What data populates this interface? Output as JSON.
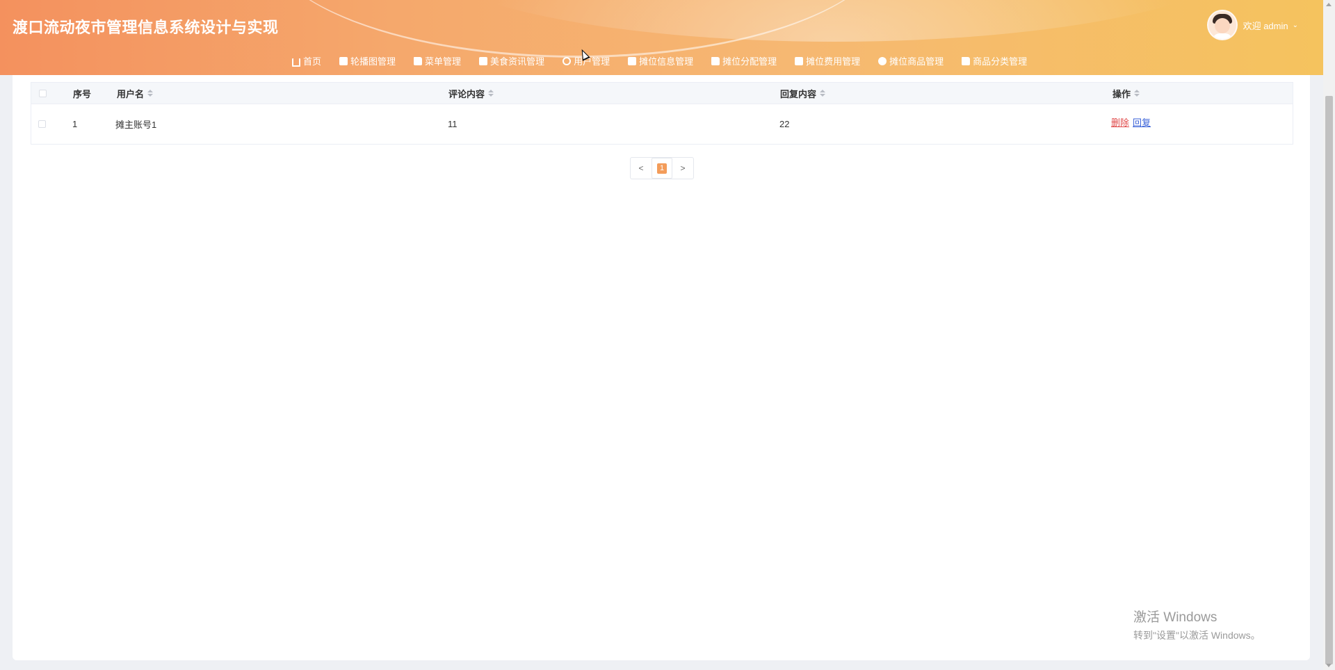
{
  "header": {
    "title": "渡口流动夜市管理信息系统设计与实现",
    "welcome": "欢迎 admin",
    "colors": {
      "gradient_start": "#f4915e",
      "gradient_end": "#f5c35e"
    }
  },
  "nav": {
    "items": [
      {
        "label": "首页",
        "icon": "home-icon"
      },
      {
        "label": "轮播图管理",
        "icon": "grid-icon"
      },
      {
        "label": "菜单管理",
        "icon": "folder-icon"
      },
      {
        "label": "美食资讯管理",
        "icon": "grid-icon"
      },
      {
        "label": "用户管理",
        "icon": "user-icon"
      },
      {
        "label": "摊位信息管理",
        "icon": "tag-icon"
      },
      {
        "label": "摊位分配管理",
        "icon": "bag-icon"
      },
      {
        "label": "摊位费用管理",
        "icon": "grid-icon"
      },
      {
        "label": "摊位商品管理",
        "icon": "circle-icon"
      },
      {
        "label": "商品分类管理",
        "icon": "folder-icon"
      }
    ]
  },
  "table": {
    "columns": [
      "序号",
      "用户名",
      "评论内容",
      "回复内容",
      "操作"
    ],
    "rows": [
      {
        "index": "1",
        "username": "摊主账号1",
        "comment": "11",
        "reply": "22",
        "delete": "删除",
        "reply_action": "回复"
      }
    ]
  },
  "pagination": {
    "prev": "<",
    "current": "1",
    "next": ">",
    "accent": "#f39c5a"
  },
  "watermark": {
    "line1": "激活 Windows",
    "line2": "转到\"设置\"以激活 Windows。"
  }
}
